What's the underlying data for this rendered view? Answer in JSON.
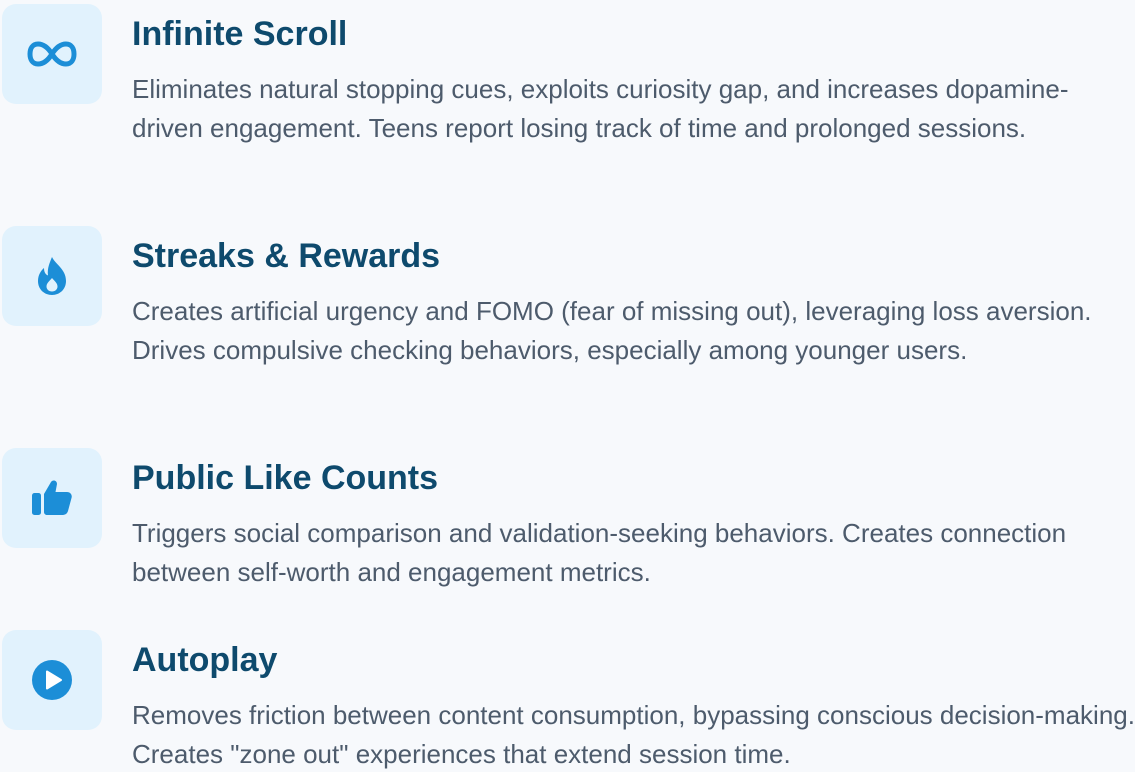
{
  "features": [
    {
      "icon": "infinity-icon",
      "title": "Infinite Scroll",
      "description": "Eliminates natural stopping cues, exploits curiosity gap, and increases dopamine-driven engagement. Teens report losing track of time and prolonged sessions."
    },
    {
      "icon": "flame-icon",
      "title": "Streaks & Rewards",
      "description": "Creates artificial urgency and FOMO (fear of missing out), leveraging loss aversion. Drives compulsive checking behaviors, especially among younger users."
    },
    {
      "icon": "thumbs-up-icon",
      "title": "Public Like Counts",
      "description": "Triggers social comparison and validation-seeking behaviors. Creates connection between self-worth and engagement metrics."
    },
    {
      "icon": "play-circle-icon",
      "title": "Autoplay",
      "description": "Removes friction between content consumption, bypassing conscious decision-making. Creates \"zone out\" experiences that extend session time."
    }
  ],
  "colors": {
    "background": "#F7F9FC",
    "icon_bg": "#E1F2FD",
    "icon": "#1C8ED7",
    "title": "#0E4A6D",
    "text": "#4D5B6C"
  }
}
